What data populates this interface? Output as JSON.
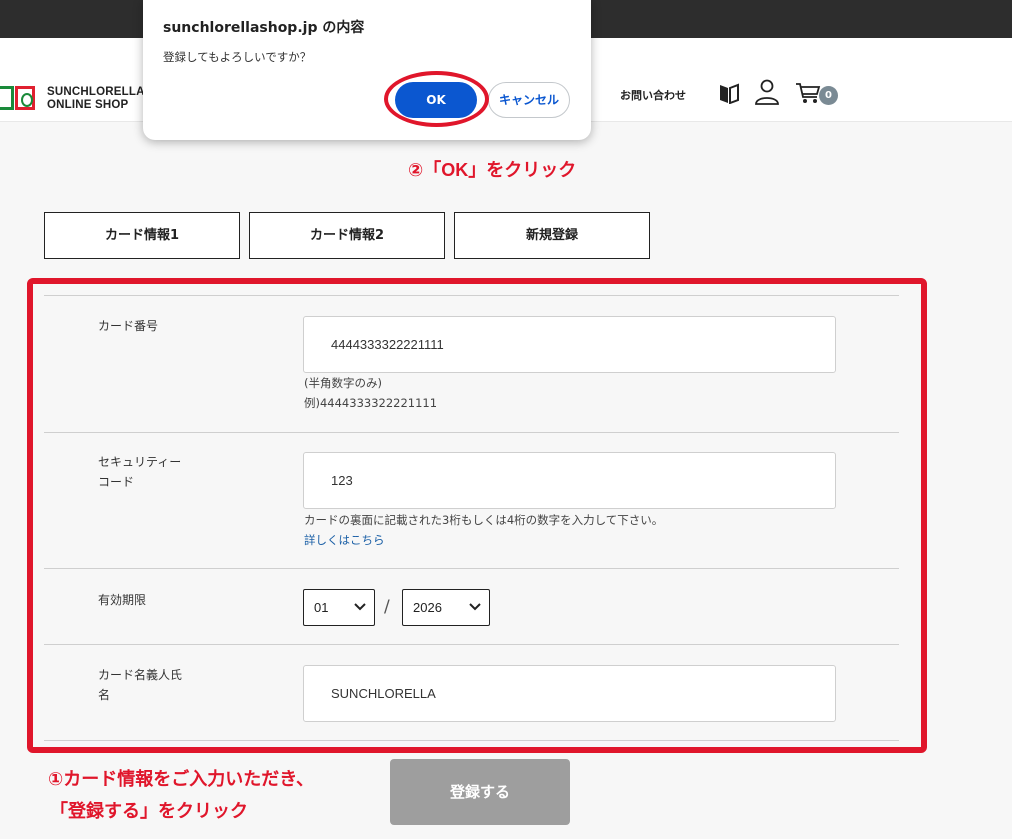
{
  "dialog": {
    "title": "sunchlorellashop.jp の内容",
    "message": "登録してもよろしいですか？",
    "ok_label": "OK",
    "cancel_label": "キャンセル"
  },
  "header": {
    "logo_line1": "SUNCHLORELLA",
    "logo_line2": "ONLINE SHOP",
    "contact_label": "お問い合わせ",
    "cart_count": "0",
    "icons": [
      "book-icon",
      "user-icon",
      "cart-icon"
    ]
  },
  "annotations": {
    "step2": "②「OK」をクリック",
    "step1_line1": "①カード情報をご入力いただき、",
    "step1_line2": "「登録する」をクリック"
  },
  "tabs": [
    "カード情報1",
    "カード情報2",
    "新規登録"
  ],
  "form": {
    "card_number": {
      "label": "カード番号",
      "value": "4444333322221111",
      "help1": "(半角数字のみ)",
      "help2": "例)4444333322221111"
    },
    "security_code": {
      "label1": "セキュリティー",
      "label2": "コード",
      "value": "123",
      "help": "カードの裏面に記載された3桁もしくは4桁の数字を入力して下さい。",
      "link": "詳しくはこちら"
    },
    "expiry": {
      "label": "有効期限",
      "month": "01",
      "separator": "/",
      "year": "2026"
    },
    "cardholder": {
      "label1": "カード名義人氏",
      "label2": "名",
      "value": "SUNCHLORELLA"
    },
    "submit_label": "登録する"
  },
  "colors": {
    "accent_red": "#e0162b",
    "dialog_blue": "#0b57d0",
    "submit_gray": "#9e9e9e",
    "topbar": "#2d2d2d"
  }
}
